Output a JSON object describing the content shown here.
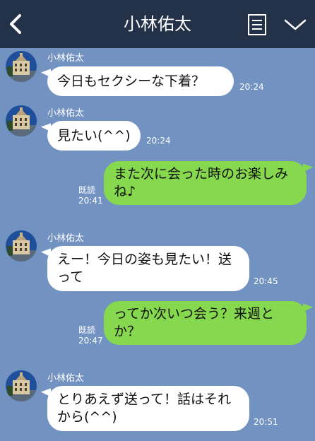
{
  "header": {
    "title": "小林佑太",
    "back_icon": "chevron-left-icon",
    "menu_icon": "list-icon",
    "expand_icon": "chevron-down-icon"
  },
  "colors": {
    "header_bg": "#233149",
    "chat_bg": "#7293c2",
    "incoming_bubble": "#ffffff",
    "outgoing_bubble": "#86d84e"
  },
  "messages": [
    {
      "direction": "incoming",
      "sender": "小林佑太",
      "text": "今日もセクシーな下着？",
      "time": "20:24"
    },
    {
      "direction": "incoming",
      "sender": "小林佑太",
      "text": "見たい(^^)",
      "time": "20:24"
    },
    {
      "direction": "outgoing",
      "read": "既読",
      "text": "また次に会った時のお楽しみね♪",
      "time": "20:41"
    },
    {
      "direction": "incoming",
      "sender": "小林佑太",
      "text": "えー！今日の姿も見たい！送って",
      "time": "20:45"
    },
    {
      "direction": "outgoing",
      "read": "既読",
      "text": "ってか次いつ会う？来週とか？",
      "time": "20:47"
    },
    {
      "direction": "incoming",
      "sender": "小林佑太",
      "text": "とりあえず送って！話はそれから(^^)",
      "time": "20:51"
    }
  ]
}
